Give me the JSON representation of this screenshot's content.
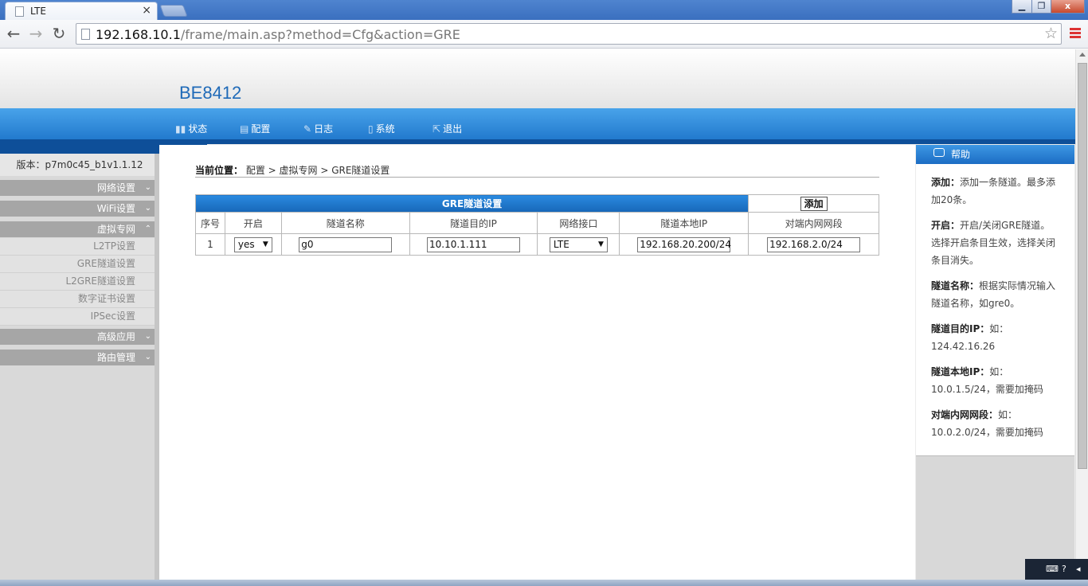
{
  "browser": {
    "tab_title": "LTE",
    "tab_close": "×",
    "url_host": "192.168.10.1",
    "url_path": "/frame/main.asp?method=Cfg&action=GRE",
    "win_minimize": "▁",
    "win_restore": "❐",
    "win_close": "x"
  },
  "header": {
    "logo": "BE8412",
    "nav": [
      {
        "label": "状态",
        "icon": "bar-chart-icon"
      },
      {
        "label": "配置",
        "icon": "config-icon"
      },
      {
        "label": "日志",
        "icon": "wrench-icon"
      },
      {
        "label": "系统",
        "icon": "document-icon"
      },
      {
        "label": "退出",
        "icon": "logout-icon"
      }
    ]
  },
  "sidebar": {
    "version": "版本：p7m0c45_b1v1.1.12",
    "groups": [
      {
        "label": "网络设置",
        "expanded": false
      },
      {
        "label": "WiFi设置",
        "expanded": false
      },
      {
        "label": "虚拟专网",
        "expanded": true
      }
    ],
    "vpn_items": [
      "L2TP设置",
      "GRE隧道设置",
      "L2GRE隧道设置",
      "数字证书设置",
      "IPSec设置"
    ],
    "groups_after": [
      {
        "label": "高级应用",
        "expanded": false
      },
      {
        "label": "路由管理",
        "expanded": false
      }
    ]
  },
  "breadcrumb": {
    "label": "当前位置：",
    "path": "配置 > 虚拟专网 > GRE隧道设置"
  },
  "gre_table": {
    "title": "GRE隧道设置",
    "add_button": "添加",
    "columns": [
      "序号",
      "开启",
      "隧道名称",
      "隧道目的IP",
      "网络接口",
      "隧道本地IP",
      "对端内网网段"
    ],
    "rows": [
      {
        "index": "1",
        "enabled": "yes",
        "name": "g0",
        "dest_ip": "10.10.1.111",
        "interface": "LTE",
        "local_ip": "192.168.20.200/24",
        "peer_subnet": "192.168.2.0/24"
      }
    ]
  },
  "help": {
    "title": "帮助",
    "entries": [
      {
        "term": "添加：",
        "desc": "添加一条隧道。最多添加20条。"
      },
      {
        "term": "开启：",
        "desc": "开启/关闭GRE隧道。选择开启条目生效，选择关闭条目消失。"
      },
      {
        "term": "隧道名称：",
        "desc": "根据实际情况输入隧道名称，如gre0。"
      },
      {
        "term": "隧道目的IP：",
        "desc": "如：124.42.16.26"
      },
      {
        "term": "隧道本地IP：",
        "desc": "如：10.0.1.5/24，需要加掩码"
      },
      {
        "term": "对端内网网段：",
        "desc": "如：10.0.2.0/24，需要加掩码"
      }
    ]
  },
  "colors": {
    "brand_blue": "#1f6ab8",
    "nav_gradient_top": "#49a3ea",
    "nav_gradient_bottom": "#1c73c9"
  }
}
